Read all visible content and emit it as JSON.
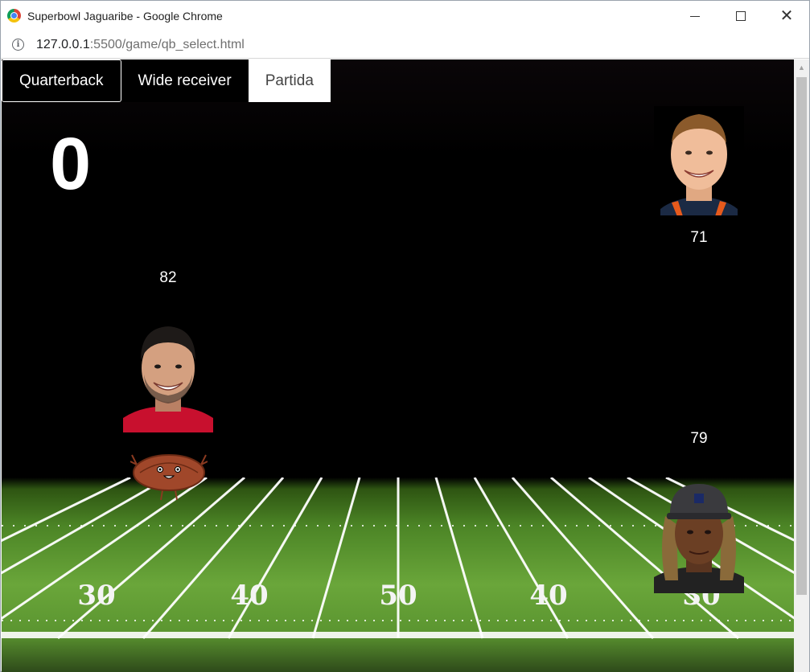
{
  "window": {
    "title": "Superbowl Jaguaribe - Google Chrome",
    "url_host": "127.0.0.1",
    "url_path": ":5500/game/qb_select.html"
  },
  "tabs": [
    {
      "label": "Quarterback",
      "state": "selected"
    },
    {
      "label": "Wide receiver",
      "state": "default"
    },
    {
      "label": "Partida",
      "state": "inactive"
    }
  ],
  "score": "0",
  "players": [
    {
      "id": "qb-top-right",
      "rating": "71",
      "jersey_color": "#1b2a44",
      "accent_color": "#e65a1c"
    },
    {
      "id": "qb-left",
      "rating": "82",
      "jersey_color": "#c8102e"
    },
    {
      "id": "wr-bottom-right",
      "rating": "79",
      "jersey_color": "#222222"
    }
  ],
  "field": {
    "yard_numbers": [
      "30",
      "40",
      "50",
      "40",
      "30"
    ]
  },
  "colors": {
    "background": "#000000",
    "field_green": "#6aa63a",
    "football": "#a0472a"
  }
}
